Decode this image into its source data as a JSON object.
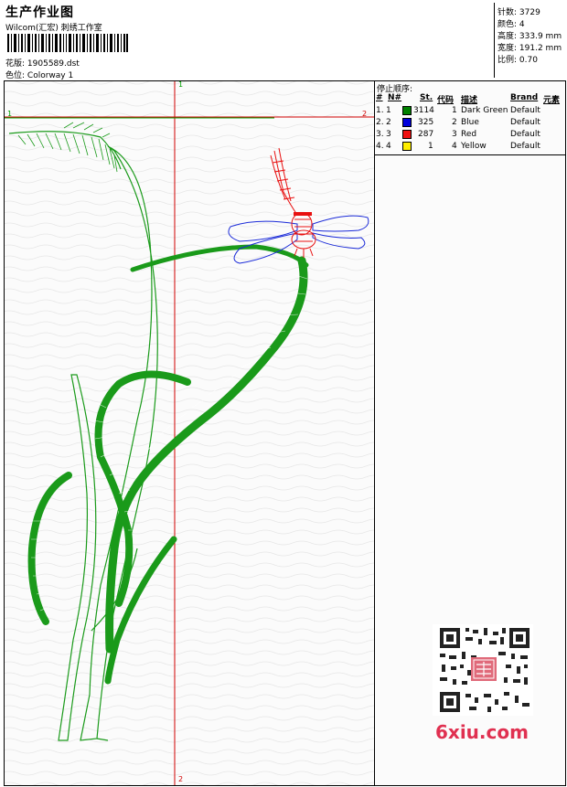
{
  "header": {
    "title": "生产作业图",
    "subtitle": "Wilcom(汇宏) 刺绣工作室",
    "pattern_label": "花版:",
    "pattern_value": "1905589.dst",
    "colorway_label": "色位:",
    "colorway_value": "Colorway 1"
  },
  "stats": {
    "stitches_label": "针数:",
    "stitches": "3729",
    "colors_label": "颜色:",
    "colors": "4",
    "height_label": "高度:",
    "height": "333.9 mm",
    "width_label": "宽度:",
    "width": "191.2 mm",
    "ratio_label": "比例:",
    "ratio": "0.70"
  },
  "axis_markers": {
    "top": "1",
    "bottom": "2",
    "left": "1",
    "right": "2"
  },
  "stop_sequence": {
    "title": "停止顺序:",
    "columns": [
      "#",
      "N#",
      "St.",
      "代码",
      "描述",
      "Brand",
      "元素"
    ],
    "rows": [
      {
        "idx": "1.",
        "n": "1",
        "color": "#008000",
        "st": "3114",
        "code": "1",
        "desc": "Dark Green",
        "brand": "Default"
      },
      {
        "idx": "2.",
        "n": "2",
        "color": "#0000dd",
        "st": "325",
        "code": "2",
        "desc": "Blue",
        "brand": "Default"
      },
      {
        "idx": "3.",
        "n": "3",
        "color": "#ee1111",
        "st": "287",
        "code": "3",
        "desc": "Red",
        "brand": "Default"
      },
      {
        "idx": "4.",
        "n": "4",
        "color": "#ffee00",
        "st": "1",
        "code": "4",
        "desc": "Yellow",
        "brand": "Default"
      }
    ]
  },
  "watermark": {
    "site": "6xiu.com",
    "qr_icon": "qr-code-icon"
  },
  "colors": {
    "green": "#1a9a1a",
    "blue": "#1a2ad8",
    "red": "#e81010",
    "guide_red": "#d00000",
    "guide_green": "#00a000"
  }
}
